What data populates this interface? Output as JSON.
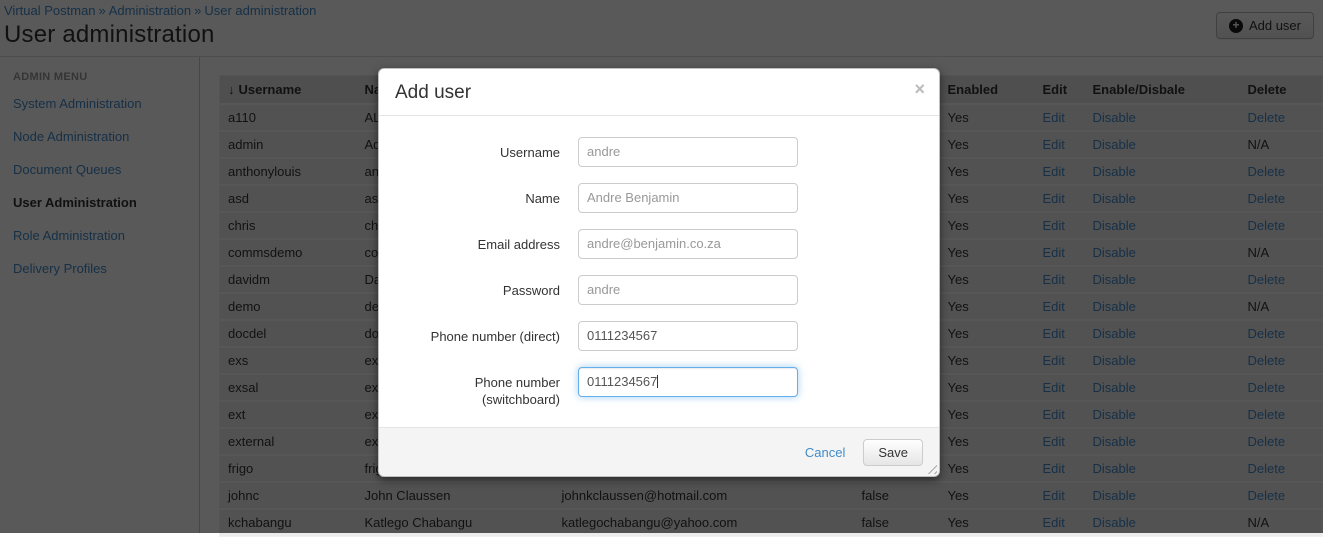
{
  "breadcrumb": {
    "separator": "»",
    "items": [
      "Virtual Postman",
      "Administration",
      "User administration"
    ]
  },
  "page": {
    "title": "User administration",
    "add_user_label": "Add user",
    "add_icon": "+"
  },
  "sidebar": {
    "heading": "ADMIN MENU",
    "items": [
      {
        "label": "System Administration",
        "active": false
      },
      {
        "label": "Node Administration",
        "active": false
      },
      {
        "label": "Document Queues",
        "active": false
      },
      {
        "label": "User Administration",
        "active": true
      },
      {
        "label": "Role Administration",
        "active": false
      },
      {
        "label": "Delivery Profiles",
        "active": false
      }
    ]
  },
  "table": {
    "sort_descending_icon": "↓",
    "headers": {
      "username": "Username",
      "name": "Name",
      "email": "",
      "flag": "",
      "enabled": "Enabled",
      "edit": "Edit",
      "enable_disable": "Enable/Disbale",
      "delete": "Delete"
    },
    "rows": [
      {
        "username": "a110",
        "name": "ALI",
        "email": "",
        "flag": "",
        "enabled": "Yes",
        "edit": "Edit",
        "enable_disable": "Disable",
        "delete": "Delete"
      },
      {
        "username": "admin",
        "name": "Adm",
        "email": "",
        "flag": "",
        "enabled": "Yes",
        "edit": "Edit",
        "enable_disable": "Disable",
        "delete": "N/A"
      },
      {
        "username": "anthonylouis",
        "name": "ant",
        "email": "",
        "flag": "",
        "enabled": "Yes",
        "edit": "Edit",
        "enable_disable": "Disable",
        "delete": "Delete"
      },
      {
        "username": "asd",
        "name": "asd",
        "email": "",
        "flag": "",
        "enabled": "Yes",
        "edit": "Edit",
        "enable_disable": "Disable",
        "delete": "Delete"
      },
      {
        "username": "chris",
        "name": "chr",
        "email": "",
        "flag": "",
        "enabled": "Yes",
        "edit": "Edit",
        "enable_disable": "Disable",
        "delete": "Delete"
      },
      {
        "username": "commsdemo",
        "name": "com",
        "email": "",
        "flag": "",
        "enabled": "Yes",
        "edit": "Edit",
        "enable_disable": "Disable",
        "delete": "N/A"
      },
      {
        "username": "davidm",
        "name": "Dav",
        "email": "",
        "flag": "",
        "enabled": "Yes",
        "edit": "Edit",
        "enable_disable": "Disable",
        "delete": "Delete"
      },
      {
        "username": "demo",
        "name": "dem",
        "email": "",
        "flag": "",
        "enabled": "Yes",
        "edit": "Edit",
        "enable_disable": "Disable",
        "delete": "N/A"
      },
      {
        "username": "docdel",
        "name": "doc",
        "email": "",
        "flag": "",
        "enabled": "Yes",
        "edit": "Edit",
        "enable_disable": "Disable",
        "delete": "Delete"
      },
      {
        "username": "exs",
        "name": "exs",
        "email": "",
        "flag": "",
        "enabled": "Yes",
        "edit": "Edit",
        "enable_disable": "Disable",
        "delete": "Delete"
      },
      {
        "username": "exsal",
        "name": "exs",
        "email": "",
        "flag": "",
        "enabled": "Yes",
        "edit": "Edit",
        "enable_disable": "Disable",
        "delete": "Delete"
      },
      {
        "username": "ext",
        "name": "ext",
        "email": "",
        "flag": "",
        "enabled": "Yes",
        "edit": "Edit",
        "enable_disable": "Disable",
        "delete": "Delete"
      },
      {
        "username": "external",
        "name": "ext",
        "email": "",
        "flag": "",
        "enabled": "Yes",
        "edit": "Edit",
        "enable_disable": "Disable",
        "delete": "Delete"
      },
      {
        "username": "frigo",
        "name": "frig",
        "email": "",
        "flag": "",
        "enabled": "Yes",
        "edit": "Edit",
        "enable_disable": "Disable",
        "delete": "Delete"
      },
      {
        "username": "johnc",
        "name": "John Claussen",
        "email": "johnkclaussen@hotmail.com",
        "flag": "false",
        "enabled": "Yes",
        "edit": "Edit",
        "enable_disable": "Disable",
        "delete": "Delete"
      },
      {
        "username": "kchabangu",
        "name": "Katlego Chabangu",
        "email": "katlegochabangu@yahoo.com",
        "flag": "false",
        "enabled": "Yes",
        "edit": "Edit",
        "enable_disable": "Disable",
        "delete": "N/A"
      }
    ]
  },
  "modal": {
    "title": "Add user",
    "close_icon": "×",
    "fields": [
      {
        "label": "Username",
        "value": "andre",
        "muted": true,
        "focused": false
      },
      {
        "label": "Name",
        "value": "Andre Benjamin",
        "muted": true,
        "focused": false
      },
      {
        "label": "Email address",
        "value": "andre@benjamin.co.za",
        "muted": true,
        "focused": false
      },
      {
        "label": "Password",
        "value": "andre",
        "muted": true,
        "focused": false
      },
      {
        "label": "Phone number (direct)",
        "value": "0111234567",
        "muted": false,
        "focused": false
      },
      {
        "label": "Phone number (switchboard)",
        "value": "0111234567",
        "muted": false,
        "focused": true
      }
    ],
    "cancel_label": "Cancel",
    "save_label": "Save"
  },
  "colors": {
    "link_blue": "#428bca",
    "focus_blue": "#66afe9",
    "backdrop": "rgba(0,0,0,0.65)",
    "text": "#333333"
  }
}
